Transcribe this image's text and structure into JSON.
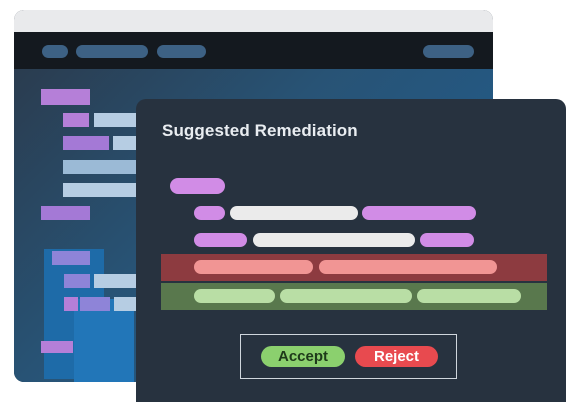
{
  "panel": {
    "title": "Suggested Remediation"
  },
  "actions": {
    "accept_label": "Accept",
    "reject_label": "Reject"
  },
  "colors": {
    "code_purple": "#d18ce6",
    "code_white": "#ebebeb",
    "removed_line": "#8d3b40",
    "added_line": "#59784d",
    "accept": "#8bd06e",
    "reject": "#e84a4f"
  }
}
